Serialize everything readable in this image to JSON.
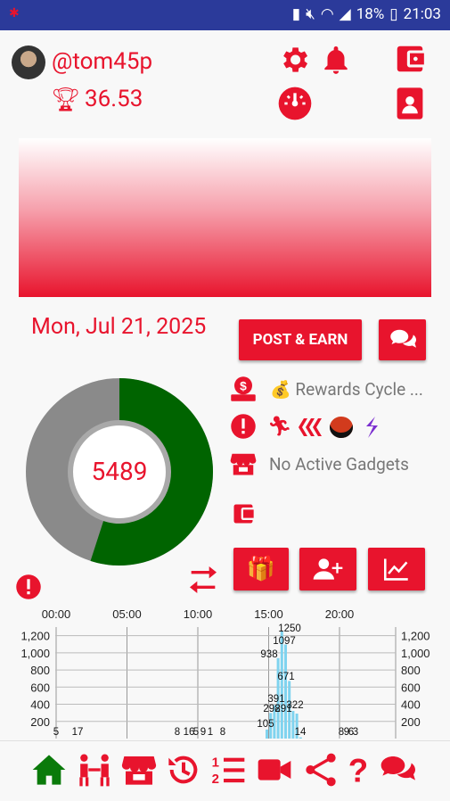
{
  "status": {
    "battery": "18%",
    "time": "21:03"
  },
  "user": {
    "handle": "@tom45p",
    "score": "36.53"
  },
  "date": "Mon, Jul 21, 2025",
  "buttons": {
    "post_earn": "POST & EARN"
  },
  "donut": {
    "value": "5489",
    "green_fraction": 0.55
  },
  "info": {
    "rewards": "💰 Rewards Cycle ...",
    "gadgets": "No Active Gadgets"
  },
  "colors": {
    "accent": "#e8142d",
    "green": "#006400",
    "gray": "#8a8a8a",
    "statusbar": "#2b3a9a"
  },
  "chart_data": {
    "type": "bar",
    "x_ticks": [
      "00:00",
      "05:00",
      "10:00",
      "15:00",
      "20:00"
    ],
    "y_ticks": [
      "1,200",
      "1,000",
      "800",
      "600",
      "400",
      "200"
    ],
    "ylim": [
      0,
      1300
    ],
    "data_labels": [
      "5",
      "17",
      "8",
      "16",
      "5",
      "9",
      "1",
      "8",
      "1250",
      "1097",
      "938",
      "671",
      "391",
      "298",
      "291",
      "322",
      "105",
      "14",
      "8",
      "9",
      "6",
      "3"
    ],
    "series": [
      {
        "values": [
          105,
          298,
          391,
          938,
          1250,
          1097,
          671,
          322,
          291,
          14
        ]
      }
    ]
  },
  "nav_icons": [
    "home-icon",
    "people-icon",
    "store-icon",
    "history-icon",
    "ranking-icon",
    "video-icon",
    "share-icon",
    "help-icon",
    "chat-icon"
  ]
}
